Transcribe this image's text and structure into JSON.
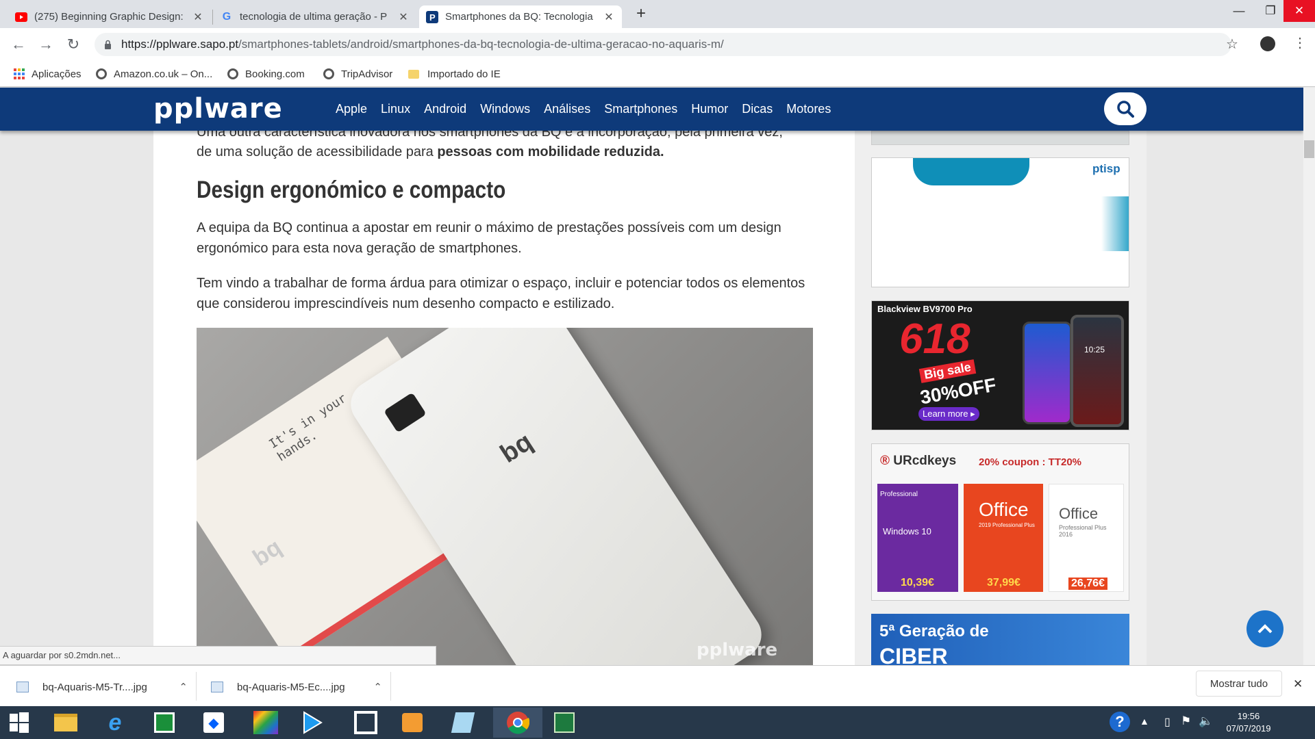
{
  "browser": {
    "tabs": [
      {
        "title": "(275) Beginning Graphic Design:",
        "icon": "youtube-icon",
        "active": false
      },
      {
        "title": "tecnologia de ultima geração - P",
        "icon": "google-icon",
        "active": false
      },
      {
        "title": "Smartphones da BQ: Tecnologia",
        "icon": "pplware-icon",
        "active": true
      }
    ],
    "new_tab": "+",
    "window_controls": {
      "minimize": "—",
      "maximize": "❐",
      "close": "✕"
    },
    "url_host": "https://pplware.sapo.pt",
    "url_path": "/smartphones-tablets/android/smartphones-da-bq-tecnologia-de-ultima-geracao-no-aquaris-m/",
    "bookmarks": [
      {
        "label": "Aplicações",
        "icon": "apps-icon"
      },
      {
        "label": "Amazon.co.uk – On...",
        "icon": "globe-icon"
      },
      {
        "label": "Booking.com",
        "icon": "globe-icon"
      },
      {
        "label": "TripAdvisor",
        "icon": "globe-icon"
      },
      {
        "label": "Importado do IE",
        "icon": "folder-icon"
      }
    ]
  },
  "site": {
    "logo": "pplware",
    "menu": [
      "Apple",
      "Linux",
      "Android",
      "Windows",
      "Análises",
      "Smartphones",
      "Humor",
      "Dicas",
      "Motores"
    ]
  },
  "article": {
    "intro_partial": "Uma outra característica inovadora nos smartphones da BQ é a incorporação, pela primeira vez,",
    "intro_line2_a": "de uma solução de acessibilidade para ",
    "intro_line2_bold": "pessoas com mobilidade reduzida.",
    "heading": "Design ergonómico e compacto",
    "para1": "A equipa da BQ continua a apostar em reunir o máximo de prestações possíveis com um design ergonómico para esta nova geração de smartphones.",
    "para2": "Tem vindo a trabalhar de forma árdua para otimizar o espaço, incluir e potenciar todos os elementos que considerou imprescindíveis num desenho compacto e estilizado.",
    "photo_box_text": "It's in your hands.",
    "photo_brand": "bq",
    "photo_watermark": "pplware"
  },
  "ads": {
    "ptisp_label": "ptisp",
    "blackview": {
      "title": "Blackview BV9700 Pro",
      "big": "618",
      "sale": "Big sale",
      "off": "30%OFF",
      "cta": "Learn more ▸",
      "time": "10:25"
    },
    "urcdkeys": {
      "brand": "URcdkeys",
      "coupon": "20% coupon : TT20%",
      "products": [
        {
          "label": "Windows 10",
          "tag": "Professional",
          "price": "10,39€"
        },
        {
          "label": "Office",
          "tag": "2019 Professional Plus",
          "price": "37,99€"
        },
        {
          "label": "Office",
          "tag": "Professional Plus 2016",
          "price": "26,76€"
        }
      ]
    },
    "ciber": {
      "line1": "5ª Geração de",
      "line2": "CIBER"
    }
  },
  "status_text": "A aguardar por s0.2mdn.net...",
  "downloads": {
    "items": [
      "bq-Aquaris-M5-Tr....jpg",
      "bq-Aquaris-M5-Ec....jpg"
    ],
    "show_all": "Mostrar tudo",
    "close": "✕"
  },
  "taskbar": {
    "apps": [
      "windows-start-icon",
      "file-explorer-icon",
      "internet-explorer-icon",
      "store-icon",
      "dropbox-icon",
      "photo-app-icon",
      "media-player-icon",
      "terminal-icon",
      "video-icon",
      "notes-icon",
      "chrome-icon",
      "excel-icon"
    ],
    "time": "19:56",
    "date": "07/07/2019"
  },
  "colors": {
    "site_nav": "#0e3a7a",
    "accent": "#1d73c9",
    "tab_strip": "#dee1e6"
  }
}
